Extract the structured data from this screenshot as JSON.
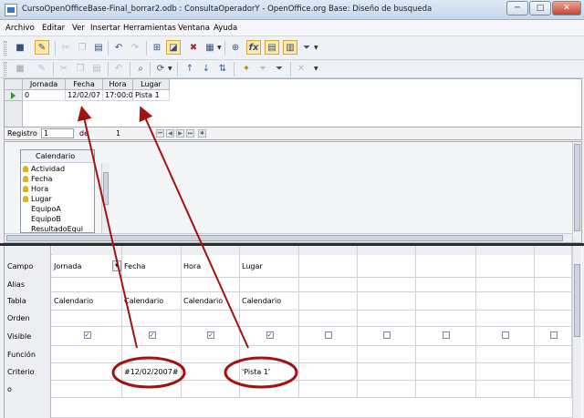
{
  "window": {
    "title": "CursoOpenOfficeBase-Final_borrar2.odb : ConsultaOperadorY - OpenOffice.org Base: Diseño de busqueda",
    "minimize_glyph": "─",
    "maximize_glyph": "□",
    "close_glyph": "✕"
  },
  "menu": [
    "Archivo",
    "Editar",
    "Ver",
    "Insertar",
    "Herramientas",
    "Ventana",
    "Ayuda"
  ],
  "toolbar": {
    "icons": [
      "save-icon",
      "edit-mode-icon",
      "cut-icon",
      "copy-icon",
      "paste-icon",
      "undo-icon",
      "redo-icon",
      "add-table-icon",
      "sql-view-icon",
      "clear-query-icon",
      "design-view-icon",
      "functions-icon",
      "table-names-icon",
      "aliases-icon",
      "distinct-values-icon"
    ],
    "function_glyph": "fx",
    "nav_icons": [
      "save-record-icon",
      "edit-data-icon",
      "cut-icon",
      "copy-icon",
      "paste-icon",
      "undo-record-icon",
      "find-record-icon",
      "refresh-icon",
      "sort-ascending-icon",
      "sort-descending-icon",
      "sort-icon",
      "autofilter-icon",
      "standard-filter-icon",
      "apply-filter-icon",
      "remove-filter-icon"
    ]
  },
  "results": {
    "columns": [
      "Jornada",
      "Fecha",
      "Hora",
      "Lugar"
    ],
    "rows": [
      {
        "Jornada": "0",
        "Fecha": "12/02/07",
        "Hora": "17:00:00",
        "Lugar": "Pista 1"
      }
    ]
  },
  "navigator": {
    "label": "Registro",
    "current": "1",
    "of_label": "de",
    "total": "1"
  },
  "table_window": {
    "title": "Calendario",
    "fields": [
      {
        "name": "Actividad",
        "key": true
      },
      {
        "name": "Fecha",
        "key": true
      },
      {
        "name": "Hora",
        "key": true
      },
      {
        "name": "Lugar",
        "key": true
      },
      {
        "name": "EquipoA",
        "key": false
      },
      {
        "name": "EquipoB",
        "key": false
      },
      {
        "name": "ResultadoEqui",
        "key": false
      }
    ]
  },
  "design": {
    "row_labels": [
      "Campo",
      "Alias",
      "Tabla",
      "Orden",
      "Visible",
      "Función",
      "Criterio",
      "o"
    ],
    "columns": [
      {
        "field": "Jornada",
        "table": "Calendario",
        "visible": true,
        "criterion": ""
      },
      {
        "field": "Fecha",
        "table": "Calendario",
        "visible": true,
        "criterion": "#12/02/2007#"
      },
      {
        "field": "Hora",
        "table": "Calendario",
        "visible": true,
        "criterion": ""
      },
      {
        "field": "Lugar",
        "table": "Calendario",
        "visible": true,
        "criterion": "'Pista 1'"
      },
      {
        "field": "",
        "table": "",
        "visible": false,
        "criterion": ""
      },
      {
        "field": "",
        "table": "",
        "visible": false,
        "criterion": ""
      },
      {
        "field": "",
        "table": "",
        "visible": false,
        "criterion": ""
      },
      {
        "field": "",
        "table": "",
        "visible": false,
        "criterion": ""
      },
      {
        "field": "",
        "table": "",
        "visible": false,
        "criterion": ""
      }
    ],
    "check_glyph": "✓"
  },
  "annotation": {
    "color": "#a31111"
  }
}
